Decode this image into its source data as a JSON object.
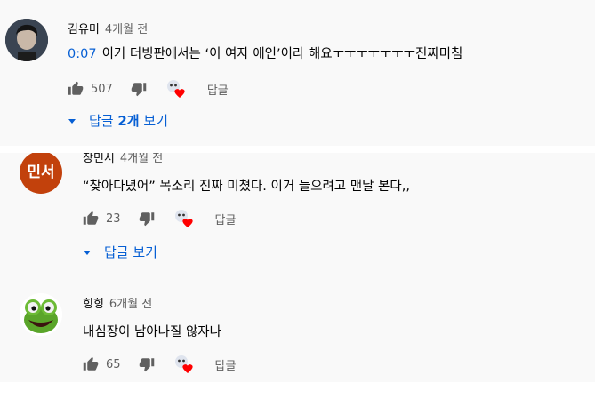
{
  "comments": [
    {
      "author": "김유미",
      "time": "4개월 전",
      "timestamp": "0:07",
      "text": "이거 더빙판에서는 ‘이 여자 애인’이라 해요ㅜㅜㅜㅜㅜㅜㅜ진짜미침",
      "likes": "507",
      "reply_label": "답글",
      "toggle": {
        "prefix": "답글 ",
        "count": "2개",
        "suffix": " 보기"
      }
    },
    {
      "author": "장민서",
      "time": "4개월 전",
      "avatar_text": "민서",
      "text": "“찾아다녔어” 목소리 진짜 미쳤다. 이거 들으려고 맨날 본다,,",
      "likes": "23",
      "reply_label": "답글",
      "toggle": {
        "label": "답글 보기"
      }
    },
    {
      "author": "힝힝",
      "time": "6개월 전",
      "text": "내심장이 남아나질 않자나",
      "likes": "65",
      "reply_label": "답글"
    }
  ],
  "icons": {
    "like": "thumbs-up-icon",
    "dislike": "thumbs-down-icon",
    "creator_heart": "creator-heart-icon",
    "caret": "caret-down-icon"
  },
  "colors": {
    "link_blue": "#065fd4",
    "heart_red": "#ff0000",
    "avatar_red": "#c2410c",
    "panel_bg": "#f9f9f9"
  }
}
